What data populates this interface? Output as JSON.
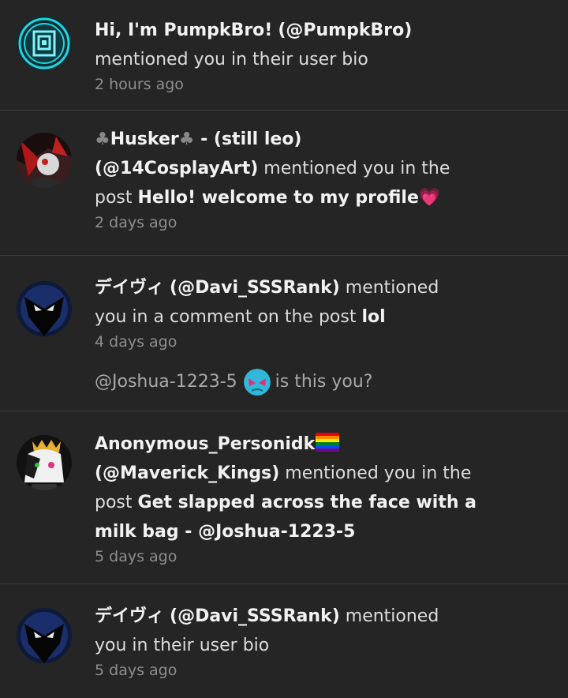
{
  "notifications": [
    {
      "user_display": "Hi, I'm PumpkBro!",
      "handle": "(@PumpkBro)",
      "action": "mentioned you in their user bio",
      "time": "2 hours ago"
    },
    {
      "name_prefix_icon": "♣",
      "user_display": "Husker",
      "name_suffix_icon": "♣",
      "user_display_rest": " - (still leo)",
      "handle": "(@14CosplayArt)",
      "action_part1": " mentioned you in the",
      "action_part2": "post ",
      "post_title": "Hello! welcome to my profile",
      "post_title_emoji": "💗",
      "time": "2 days ago"
    },
    {
      "user_display": "デイヴィ",
      "handle": "(@Davi_SSSRank)",
      "action_part1": " mentioned",
      "action_part2": "you in a comment on the post ",
      "post_title": "lol",
      "time": "4 days ago",
      "comment_mention": "@Joshua-1223-5",
      "comment_text": "is this you?"
    },
    {
      "user_display": "Anonymous_Personidk",
      "user_display_emoji": "rainbow-flag",
      "handle": "(@Maverick_Kings)",
      "action_part1": " mentioned you in the",
      "action_part2": "post ",
      "post_title_line1": "Get slapped across the face with a",
      "post_title_line2": "milk bag - @Joshua-1223-5",
      "time": "5 days ago"
    },
    {
      "user_display": "デイヴィ",
      "handle": "(@Davi_SSSRank)",
      "action_part1": " mentioned",
      "action_part2": "you in their user bio",
      "time": "5 days ago"
    }
  ]
}
